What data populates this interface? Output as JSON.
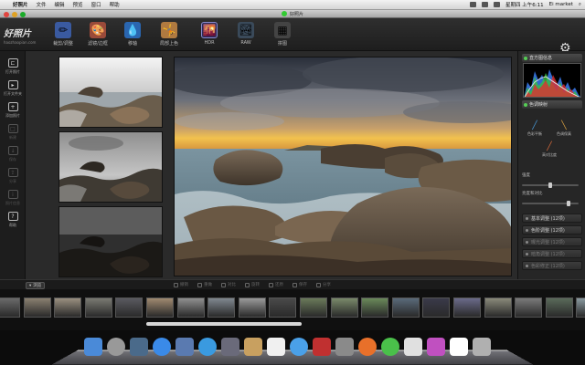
{
  "menubar": {
    "app_name": "好照片",
    "menus": [
      "文件",
      "编辑",
      "预览",
      "窗口",
      "帮助"
    ],
    "clock": "星期四 上午6:11",
    "account": "Ei market"
  },
  "window": {
    "title": "好照片"
  },
  "brand": {
    "logo": "好照片",
    "url": "haozhaopian.com"
  },
  "toolbar": {
    "tools": [
      {
        "label": "裁剪/调整",
        "icon": "pencil-ruler-icon",
        "glyph": "✏"
      },
      {
        "label": "滤镜/边框",
        "icon": "paint-bucket-icon",
        "glyph": "🎨"
      },
      {
        "label": "移轴",
        "icon": "water-drop-icon",
        "glyph": "💧"
      },
      {
        "label": "局部上色",
        "icon": "figure-brush-icon",
        "glyph": "🤸"
      },
      {
        "label": "HDR",
        "icon": "hdr-icon",
        "glyph": "🌇"
      },
      {
        "label": "RAW",
        "icon": "raw-icon",
        "glyph": "🏞"
      },
      {
        "label": "拼图",
        "icon": "collage-icon",
        "glyph": "▦"
      }
    ],
    "active_tool": "HDR"
  },
  "sidebar": {
    "items": [
      {
        "label": "打开照片",
        "icon": "folder-open-icon",
        "glyph": "⊏",
        "enabled": true
      },
      {
        "label": "打开文件夹",
        "icon": "folder-stack-icon",
        "glyph": "▸",
        "enabled": true
      },
      {
        "label": "添加照片",
        "icon": "add-photo-icon",
        "glyph": "+",
        "enabled": true
      },
      {
        "label": "新建",
        "icon": "new-icon",
        "glyph": "□",
        "enabled": false
      },
      {
        "label": "保存",
        "icon": "save-icon",
        "glyph": "↓",
        "enabled": false
      },
      {
        "label": "分享",
        "icon": "share-icon",
        "glyph": "⇪",
        "enabled": false
      },
      {
        "label": "照片信息",
        "icon": "info-icon",
        "glyph": "i",
        "enabled": false
      },
      {
        "label": "帮助",
        "icon": "help-icon",
        "glyph": "?",
        "enabled": true
      }
    ]
  },
  "right_panel": {
    "histogram_title": "直方图信息",
    "tonemap_title": "色调映射",
    "modes": [
      {
        "label": "色彩平衡",
        "icon": "balance-wand-icon",
        "glyph": "╱"
      },
      {
        "label": "色调保真",
        "icon": "fidelity-brush-icon",
        "glyph": "╲"
      },
      {
        "label": "高对比度",
        "icon": "contrast-brush-icon",
        "glyph": "╱"
      }
    ],
    "slider1_label": "强度",
    "slider1_value": 0.5,
    "slider2_label": "亮度和对比",
    "slider2_value": 0.85,
    "buttons": [
      {
        "label": "基本调整 (12项)",
        "enabled": true
      },
      {
        "label": "色阶调整 (12项)",
        "enabled": true
      },
      {
        "label": "曝光调整 (12项)",
        "enabled": false
      },
      {
        "label": "暗角调整 (12项)",
        "enabled": false
      },
      {
        "label": "色彩修正 (12项)",
        "enabled": false
      }
    ]
  },
  "actionbar": {
    "status_label": "浏览",
    "actions": [
      "撤销",
      "重做",
      "对比",
      "旋转",
      "还原",
      "保存",
      "分享"
    ]
  },
  "colors": {
    "accent": "#8a8acc",
    "panel_bg": "#262626",
    "indicator_green": "#55cc55"
  }
}
